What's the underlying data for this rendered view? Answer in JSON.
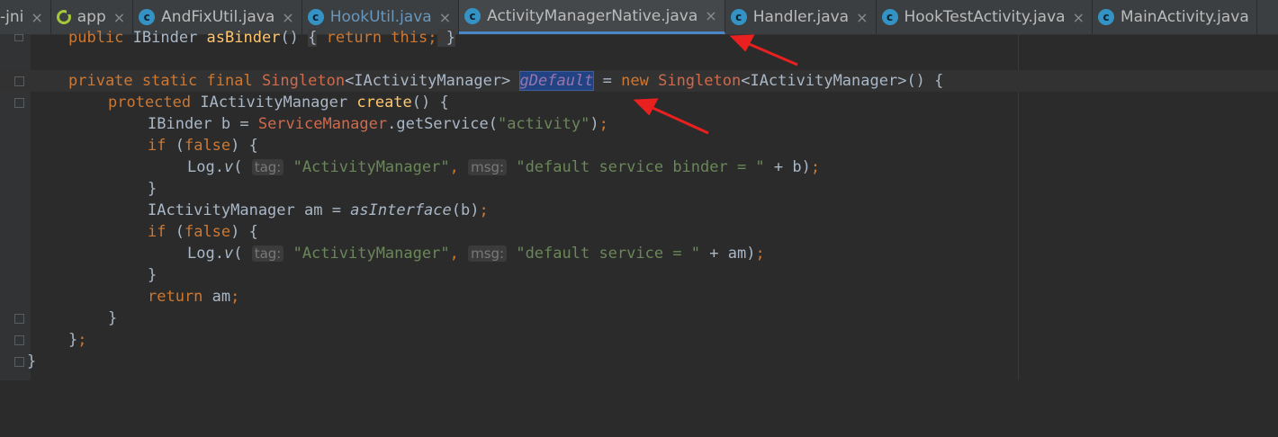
{
  "tabs": [
    {
      "label": "-jni",
      "icon": "none",
      "active": false
    },
    {
      "label": "app",
      "icon": "android-module-icon",
      "active": false
    },
    {
      "label": "AndFixUtil.java",
      "icon": "java-class-icon",
      "active": false
    },
    {
      "label": "HookUtil.java",
      "icon": "java-class-icon",
      "active": false,
      "modified": true
    },
    {
      "label": "ActivityManagerNative.java",
      "icon": "java-class-icon",
      "active": true
    },
    {
      "label": "Handler.java",
      "icon": "java-class-icon",
      "active": false
    },
    {
      "label": "HookTestActivity.java",
      "icon": "java-class-icon",
      "active": false
    },
    {
      "label": "MainActivity.java",
      "icon": "java-class-icon",
      "active": false
    }
  ],
  "tab_close_glyph": "×",
  "class_icon_glyph": "c",
  "code": {
    "l1": {
      "a": "public",
      "b": " IBinder ",
      "c": "asBinder",
      "d": "() ",
      "e": "{",
      "f": " return",
      "g": " this",
      "h": ";",
      "i": " }"
    },
    "l3": {
      "a": "private static final",
      "b": " Singleton",
      "c": "<IActivityManager> ",
      "d": "gDefault",
      "e": " = ",
      "f": "new",
      "g": " Singleton",
      "h": "<IActivityManager>() {"
    },
    "l4": {
      "a": "protected",
      "b": " IActivityManager ",
      "c": "create",
      "d": "() {"
    },
    "l5": {
      "a": "IBinder b = ",
      "b": "ServiceManager",
      "c": ".getService(",
      "d": "\"activity\"",
      "e": ")",
      "f": ";"
    },
    "l6": {
      "a": "if",
      "b": " (",
      "c": "false",
      "d": ") {"
    },
    "l7": {
      "a": "Log.",
      "b": "v",
      "c": "( ",
      "d": "tag:",
      "e": " \"ActivityManager\"",
      "f": ",",
      "g": "msg:",
      "h": " \"default service binder = \"",
      "i": " + b)",
      "j": ";"
    },
    "l8": {
      "a": "}"
    },
    "l9": {
      "a": "IActivityManager am = ",
      "b": "asInterface",
      "c": "(b)",
      "d": ";"
    },
    "l10": {
      "a": "if",
      "b": " (",
      "c": "false",
      "d": ") {"
    },
    "l11": {
      "a": "Log.",
      "b": "v",
      "c": "( ",
      "d": "tag:",
      "e": " \"ActivityManager\"",
      "f": ",",
      "g": "msg:",
      "h": " \"default service = \"",
      "i": " + am)",
      "j": ";"
    },
    "l12": {
      "a": "}"
    },
    "l13": {
      "a": "return",
      "b": " am",
      "c": ";"
    },
    "l14": {
      "a": "}"
    },
    "l15": {
      "a": "}",
      "b": ";"
    },
    "l16": {
      "a": "}"
    }
  },
  "colors": {
    "keyword": "#cc7832",
    "string": "#6a8759",
    "class": "#bbb529",
    "field": "#9876aa",
    "method": "#ffc66d",
    "annotation_arrow": "#e8201f"
  }
}
